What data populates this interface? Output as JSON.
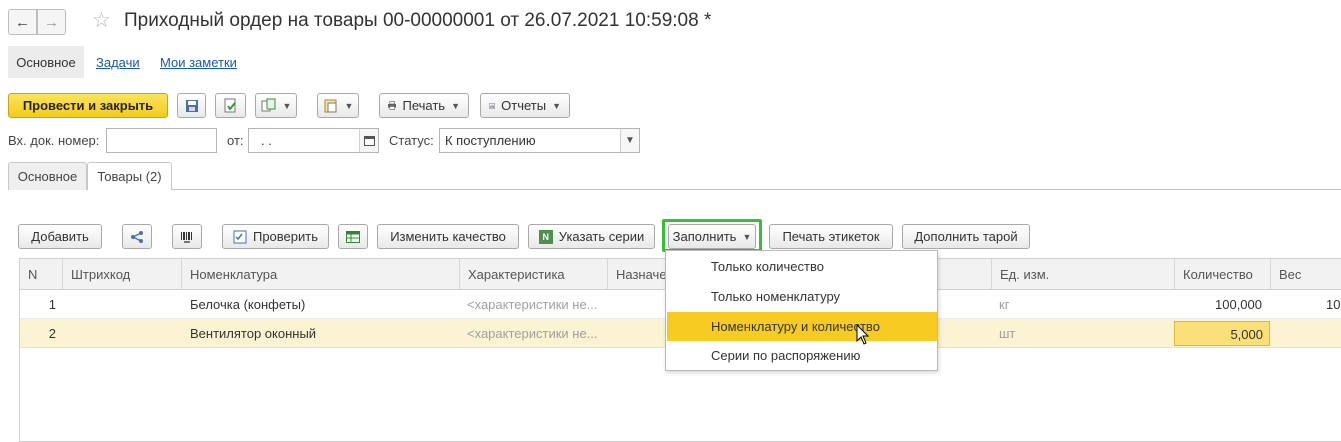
{
  "window": {
    "title": "Приходный ордер на товары 00-00000001 от 26.07.2021 10:59:08 *"
  },
  "nav": {
    "back_icon": "arrow-left-icon",
    "forward_icon": "arrow-right-icon",
    "favorite_icon": "star-icon"
  },
  "sections": {
    "active": "Основное",
    "links": [
      "Задачи",
      "Мои заметки"
    ]
  },
  "toolbar": {
    "post_close": "Провести и закрыть",
    "print": "Печать",
    "reports": "Отчеты"
  },
  "form": {
    "in_doc_label": "Вх. док. номер:",
    "in_doc_value": "",
    "from_label": "от:",
    "date_value": ".  .",
    "status_label": "Статус:",
    "status_value": "К поступлению"
  },
  "tabs": [
    "Основное",
    "Товары (2)"
  ],
  "table_toolbar": {
    "add": "Добавить",
    "check": "Проверить",
    "change_quality": "Изменить качество",
    "set_series": "Указать серии",
    "fill": "Заполнить",
    "print_labels": "Печать этикеток",
    "add_container": "Дополнить тарой"
  },
  "table": {
    "headers": [
      "N",
      "Штрихкод",
      "Номенклатура",
      "Характеристика",
      "Назначе",
      "Ед. изм.",
      "Количество",
      "Вес"
    ],
    "rows": [
      {
        "n": "1",
        "barcode": "",
        "item": "Белочка (конфеты)",
        "characteristic": "<характеристики не...",
        "unit": "кг",
        "qty": "100,000",
        "weight": "10"
      },
      {
        "n": "2",
        "barcode": "",
        "item": "Вентилятор оконный",
        "characteristic": "<характеристики не...",
        "unit": "шт",
        "qty": "5,000",
        "weight": ""
      }
    ]
  },
  "fill_menu": {
    "items": [
      "Только количество",
      "Только номенклатуру",
      "Номенклатуру и количество",
      "Серии по распоряжению"
    ],
    "selected": "Номенклатуру и количество"
  },
  "colors": {
    "accent_yellow": "#f7cb22",
    "highlight_green": "#36c134",
    "link_blue": "#1a5aa6"
  }
}
